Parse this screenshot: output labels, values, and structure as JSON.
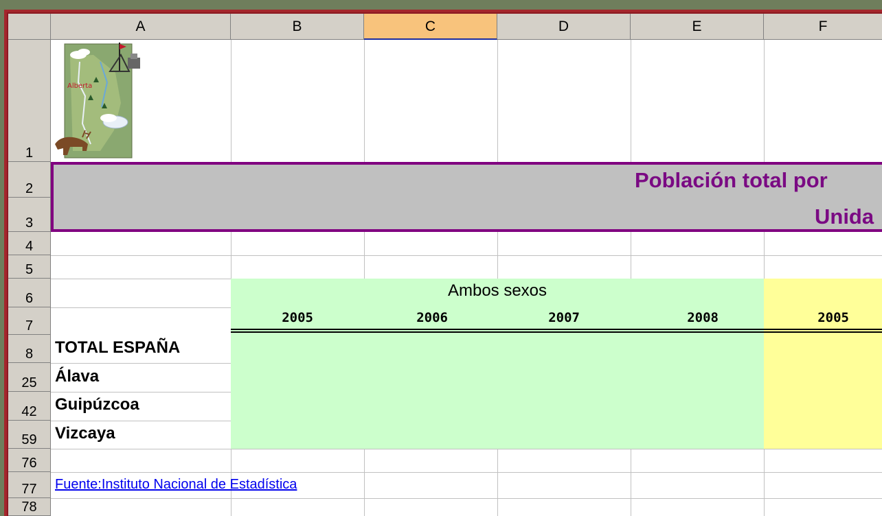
{
  "columns": [
    "A",
    "B",
    "C",
    "D",
    "E",
    "F"
  ],
  "selected_column": "C",
  "rows": {
    "r1": "1",
    "r2": "2",
    "r3": "3",
    "r4": "4",
    "r5": "5",
    "r6": "6",
    "r7": "7",
    "r8": "8",
    "r25": "25",
    "r42": "42",
    "r59": "59",
    "r76": "76",
    "r77": "77",
    "r78": "78"
  },
  "map": {
    "label": "Alberta"
  },
  "title": {
    "line1": "Población total por",
    "line2": "Unida"
  },
  "header": {
    "group_label": "Ambos sexos",
    "years": [
      "2005",
      "2006",
      "2007",
      "2008",
      "2005"
    ]
  },
  "regions": [
    "TOTAL ESPAÑA",
    "Álava",
    "Guipúzcoa",
    "Vizcaya"
  ],
  "source_link": "Fuente:Instituto Nacional de Estadística",
  "colors": {
    "green_fill": "#ccffcc",
    "yellow_fill": "#ffff99",
    "title_band": "#c0c0c0",
    "title_border": "#800080",
    "title_text": "#7a0a83",
    "link": "#0000ee",
    "selected_header": "#f8c37c"
  }
}
